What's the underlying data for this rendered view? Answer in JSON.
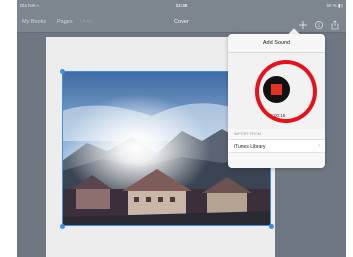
{
  "status_bar": {
    "carrier": "Dl4 hmt ≈",
    "time": "22:38",
    "battery": "50 % ▮▯"
  },
  "toolbar": {
    "my_books": "My Books",
    "pages": "Pages",
    "undo": "Undo",
    "title": "Cover",
    "icons": [
      "plus-icon",
      "info-icon",
      "share-icon"
    ]
  },
  "popover": {
    "title": "Add Sound",
    "timer": "00:00:18",
    "section_label": "IMPORT FROM",
    "row_label": "iTunes Library",
    "row_chevron": "›",
    "record_state": "recording"
  },
  "colors": {
    "highlight_ring": "#e8101a",
    "stop_button": "#e5331f",
    "selection": "#3d8fe8"
  }
}
